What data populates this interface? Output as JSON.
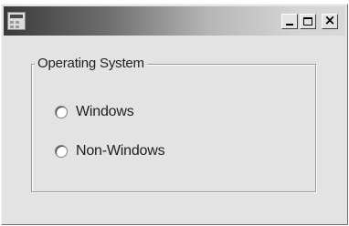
{
  "window": {
    "title": "",
    "buttons": {
      "minimize_glyph": "_",
      "maximize_glyph": "",
      "close_glyph": "×"
    }
  },
  "group": {
    "label": "Operating System",
    "options": [
      {
        "label": "Windows",
        "selected": false
      },
      {
        "label": "Non-Windows",
        "selected": false
      }
    ]
  },
  "colors": {
    "face": "#e3e3e3",
    "title_gradient_start": "#3a3a3a",
    "title_gradient_end": "#d8d8d8"
  }
}
